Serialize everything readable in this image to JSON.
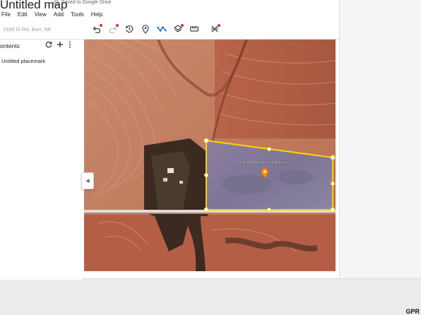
{
  "app": {
    "title": "Untitled map",
    "save_status": "Saved to Google Drive"
  },
  "menu": [
    "File",
    "Edit",
    "View",
    "Add",
    "Tools",
    "Help"
  ],
  "search": {
    "placeholder": "1939 O Rd, Burr, NE"
  },
  "toolbar": {
    "icons": [
      "undo-icon",
      "redo-icon",
      "history-icon",
      "add-marker-icon",
      "draw-line-icon",
      "layers-icon",
      "measure-icon",
      "share-icon"
    ],
    "accent": "#d93025"
  },
  "panel": {
    "contents_label": "ontents",
    "items": [
      "Untitled placemark"
    ]
  },
  "map": {
    "placemark_label": "Untitled placemark",
    "polygon_color": "#ffd400",
    "marker_color": "#ff8c1a"
  },
  "watermark": "GPR"
}
